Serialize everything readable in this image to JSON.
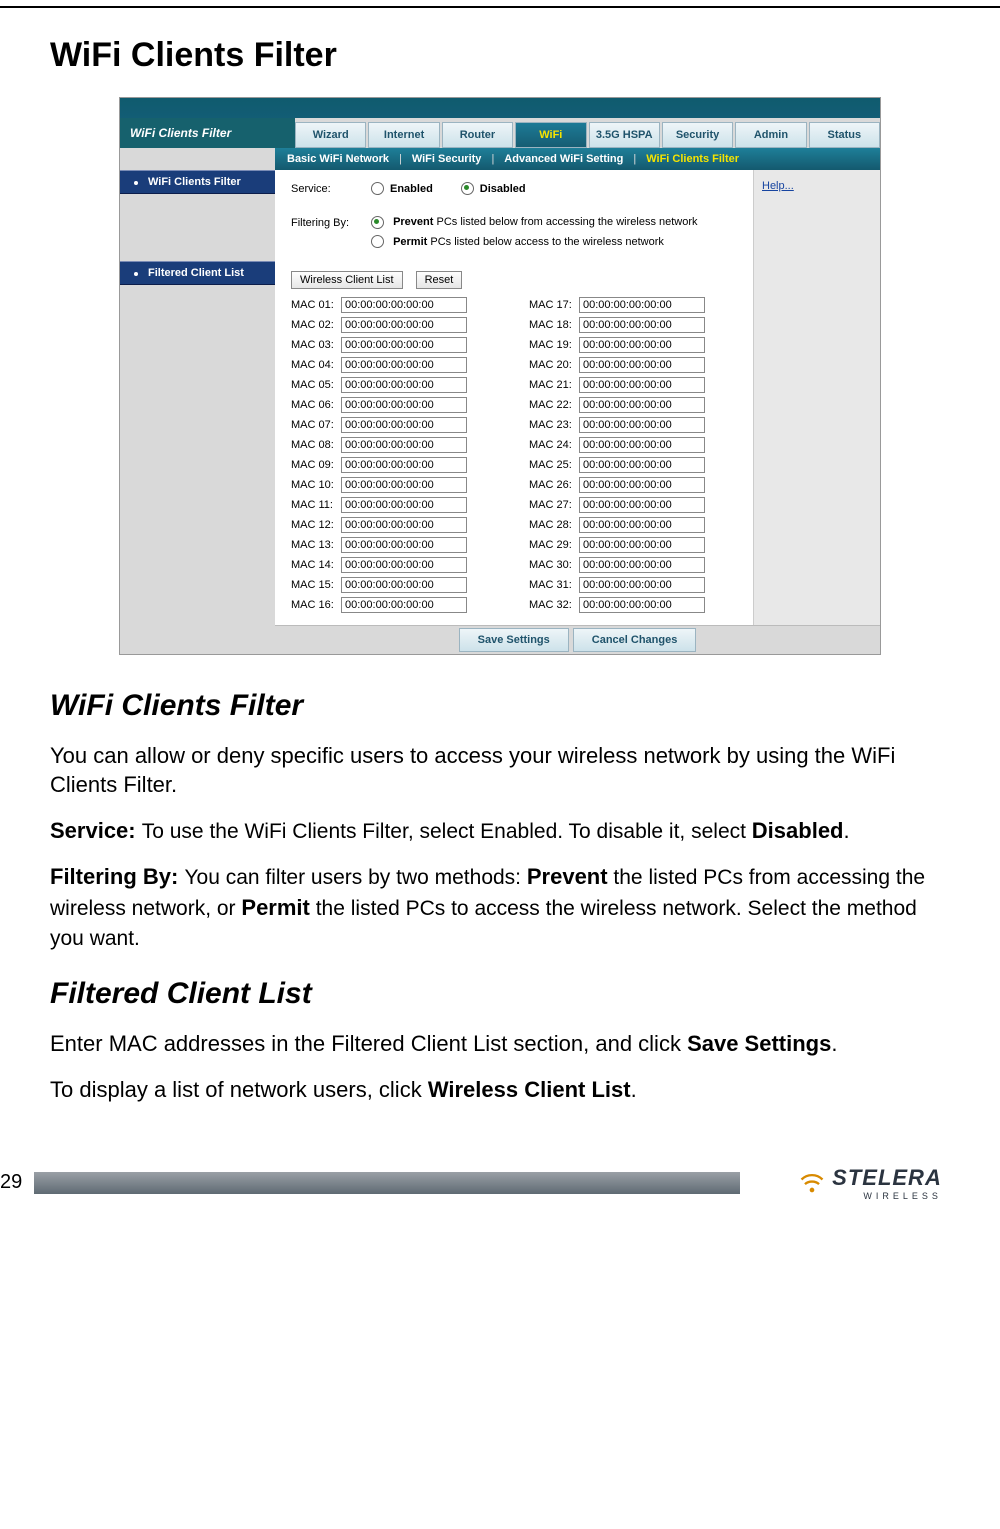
{
  "doc": {
    "title": "WiFi Clients Filter",
    "section1_title": "WiFi Clients Filter",
    "p1": "You can allow or deny specific users to access your wireless network by using the WiFi Clients Filter.",
    "p2_label": "Service: ",
    "p2_text_a": "To use the WiFi Clients Filter, select Enabled. To disable it, select ",
    "p2_bold": "Disabled",
    "p2_text_b": ".",
    "p3_label": "Filtering By: ",
    "p3_a": "You can filter users by two methods: ",
    "p3_b1": "Prevent",
    "p3_c": " the listed PCs from accessing the wireless network, or ",
    "p3_b2": "Permit",
    "p3_d": " the listed PCs to access the wireless network. Select the method you want.",
    "section2_title": "Filtered Client List",
    "p4_a": "Enter MAC addresses in the Filtered Client List section, and click ",
    "p4_b": "Save Settings",
    "p4_c": ".",
    "p5_a": "To display a list of network users, click ",
    "p5_b": "Wireless Client List",
    "p5_c": ".",
    "page_number": "29",
    "logo_brand": "STELERA",
    "logo_sub": "WIRELESS"
  },
  "ui": {
    "pane_title": "WiFi Clients Filter",
    "tabs": [
      "Wizard",
      "Internet",
      "Router",
      "WiFi",
      "3.5G HSPA",
      "Security",
      "Admin",
      "Status"
    ],
    "active_tab_index": 3,
    "subtabs": {
      "items": [
        "Basic WiFi Network",
        "WiFi Security",
        "Advanced WiFi Setting",
        "WiFi Clients Filter"
      ],
      "active_index": 3
    },
    "sidebar": {
      "head1": "WiFi Clients Filter",
      "head2": "Filtered Client List"
    },
    "help_link": "Help...",
    "service": {
      "label": "Service:",
      "opt_enabled": "Enabled",
      "opt_disabled": "Disabled",
      "selected": "Disabled"
    },
    "filtering": {
      "label": "Filtering By:",
      "opt_prevent_bold": "Prevent",
      "opt_prevent_rest": " PCs listed below from accessing the wireless network",
      "opt_permit_bold": "Permit",
      "opt_permit_rest": " PCs listed below access to the wireless network",
      "selected": "Prevent"
    },
    "buttons": {
      "wireless_list": "Wireless Client List",
      "reset": "Reset",
      "save": "Save Settings",
      "cancel": "Cancel Changes"
    },
    "mac_default": "00:00:00:00:00:00",
    "mac_label_prefix": "MAC ",
    "mac_count": 32
  }
}
